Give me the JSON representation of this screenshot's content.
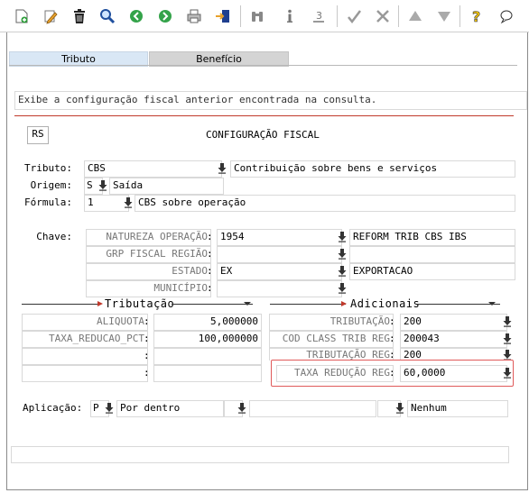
{
  "toolbar": {
    "buttons": [
      "new-doc",
      "edit",
      "delete",
      "search",
      "back",
      "forward",
      "print",
      "export",
      "binoculars",
      "info",
      "step",
      "check",
      "tools",
      "up",
      "down",
      "help",
      "chat"
    ]
  },
  "tabs": [
    {
      "label": "Tributo"
    },
    {
      "label": "Benefício"
    }
  ],
  "message": "Exibe a configuração fiscal anterior encontrada na consulta.",
  "header": {
    "uf": "RS",
    "title": "CONFIGURAÇÃO FISCAL"
  },
  "tributo": {
    "label": "Tributo:",
    "code": "CBS",
    "desc": "Contribuição sobre bens e serviços"
  },
  "origem": {
    "label": "Origem:",
    "code": "S",
    "desc": "Saída"
  },
  "formula": {
    "label": "Fórmula:",
    "code": "1",
    "desc": "CBS sobre operação"
  },
  "chave": {
    "label": "Chave:",
    "rows": [
      {
        "name": "NATUREZA OPERAÇÃO",
        "value": "1954",
        "desc": "REFORM TRIB CBS IBS"
      },
      {
        "name": "GRP FISCAL REGIÃO",
        "value": "",
        "desc": ""
      },
      {
        "name": "ESTADO",
        "value": "EX",
        "desc": "EXPORTACAO"
      },
      {
        "name": "MUNICÍPIO",
        "value": "",
        "desc": ""
      }
    ]
  },
  "tributacao": {
    "title": "Tributação",
    "rows": [
      {
        "name": "ALIQUOTA",
        "value": "5,000000"
      },
      {
        "name": "TAXA_REDUCAO_PCT",
        "value": "100,000000"
      },
      {
        "name": "",
        "value": ""
      },
      {
        "name": "",
        "value": ""
      }
    ]
  },
  "adicionais": {
    "title": "Adicionais",
    "rows": [
      {
        "name": "TRIBUTAÇÃO",
        "value": "200"
      },
      {
        "name": "COD CLASS TRIB REG",
        "value": "200043"
      },
      {
        "name": "TRIBUTAÇÃO REG",
        "value": "200"
      },
      {
        "name": "TAXA REDUÇÃO REG",
        "value": "60,0000"
      }
    ]
  },
  "aplicacao": {
    "label": "Aplicação:",
    "code1": "P",
    "desc1": "Por dentro",
    "code2": "",
    "desc2": "",
    "code3": "",
    "desc3": "Nenhum"
  },
  "colors": {
    "accent": "#c0392b",
    "tab_active": "#d9e7f5",
    "tab_inactive": "#d4d4d4"
  }
}
